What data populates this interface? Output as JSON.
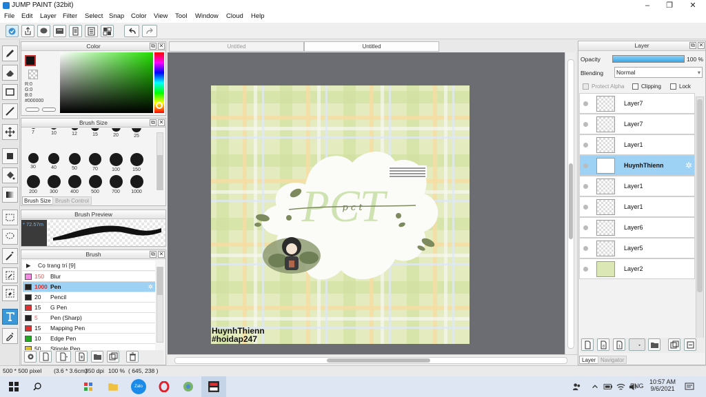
{
  "window": {
    "title": "JUMP PAINT (32bit)",
    "minimize": "–",
    "maximize": "❐",
    "close": "✕"
  },
  "menu": [
    "File",
    "Edit",
    "Layer",
    "Filter",
    "Select",
    "Snap",
    "Color",
    "View",
    "Tool",
    "Window",
    "Cloud",
    "Help"
  ],
  "toolbar": {
    "icons": [
      "cloud-icon",
      "share-icon",
      "comment-icon",
      "tablet-icon",
      "page-icon",
      "list-icon",
      "grid-settings-icon",
      "undo-icon",
      "redo-icon"
    ]
  },
  "tools": [
    "brush-icon",
    "eraser-icon",
    "select-rect-icon",
    "pen-line-icon",
    "move-icon",
    "fill-rect-icon",
    "bucket-icon",
    "gradient-icon",
    "marquee-icon",
    "lasso-icon",
    "magic-wand-icon",
    "select-pen-icon",
    "select-eraser-icon",
    "text-icon",
    "eyedropper-icon"
  ],
  "color_panel": {
    "title": "Color",
    "r_label": "R:0",
    "g_label": "G:0",
    "b_label": "B:0",
    "hex": "#000000",
    "current_color": "#000000"
  },
  "brush_size_panel": {
    "title": "Brush Size",
    "sizes": [
      "7",
      "10",
      "12",
      "15",
      "20",
      "25",
      "30",
      "40",
      "50",
      "70",
      "100",
      "150",
      "200",
      "300",
      "400",
      "500",
      "700",
      "1000"
    ],
    "tabs": [
      "Brush Size",
      "Brush Control"
    ]
  },
  "preview_panel": {
    "title": "Brush Preview",
    "size_text": "* 72.57m"
  },
  "brush_panel": {
    "title": "Brush",
    "group": "Cọ trang trí [9]",
    "items": [
      {
        "size": "150",
        "name": "Blur",
        "color": "#f08de0",
        "size_color": "#e05a5a"
      },
      {
        "size": "1000",
        "name": "Pen",
        "color": "#222222",
        "size_color": "#d03030"
      },
      {
        "size": "20",
        "name": "Pencil",
        "color": "#222222",
        "size_color": "#111111"
      },
      {
        "size": "15",
        "name": "G Pen",
        "color": "#e03030",
        "size_color": "#111111"
      },
      {
        "size": "5",
        "name": "Pen (Sharp)",
        "color": "#222222",
        "size_color": "#e05a5a"
      },
      {
        "size": "15",
        "name": "Mapping Pen",
        "color": "#e03030",
        "size_color": "#111111"
      },
      {
        "size": "10",
        "name": "Edge Pen",
        "color": "#22aa22",
        "size_color": "#111111"
      },
      {
        "size": "50",
        "name": "Stipple Pen",
        "color": "#e0c020",
        "size_color": "#111111"
      }
    ]
  },
  "canvas": {
    "tabs": [
      "Untitled",
      "Untitled"
    ],
    "watermark_name": "HuynhThienn",
    "watermark_tag": "#hoidap247",
    "logo_text": "PCT",
    "logo_subtext": "p c t",
    "colors": {
      "plaid_base": "#e4ecbf",
      "plaid_stripe": "#d2e2a2",
      "plaid_yellow": "#f6dca2",
      "plaid_white": "#f7f9ee",
      "leaf": "#7c8a5e"
    }
  },
  "layer_panel": {
    "title": "Layer",
    "opacity_label": "Opacity",
    "opacity_value": "100 %",
    "opacity": 1.0,
    "blending_label": "Blending",
    "blending_value": "Normal",
    "protect_alpha": "Protect Alpha",
    "clipping": "Clipping",
    "lock": "Lock",
    "layers": [
      "Layer7",
      "Layer7",
      "Layer1",
      "HuynhThienn",
      "Layer1",
      "Layer1",
      "Layer6",
      "Layer5",
      "Layer2"
    ],
    "selected_index": 3,
    "bottom_tabs": [
      "Layer",
      "Navigator"
    ]
  },
  "status": {
    "size": "500 * 500 pixel",
    "cm": "(3.6 * 3.6cm)",
    "dpi": "350 dpi",
    "zoom": "100 %",
    "coords": "( 645, 238 )"
  },
  "taskbar": {
    "apps": [
      "windows-icon",
      "search-icon",
      "task-view-icon",
      "file-explorer-icon",
      "zalo-icon",
      "opera-icon",
      "chrome-icon",
      "jump-paint-icon"
    ],
    "tray_lang": "ENG",
    "time": "10:57 AM",
    "date": "9/6/2021",
    "zalo_label": "Zalo"
  }
}
